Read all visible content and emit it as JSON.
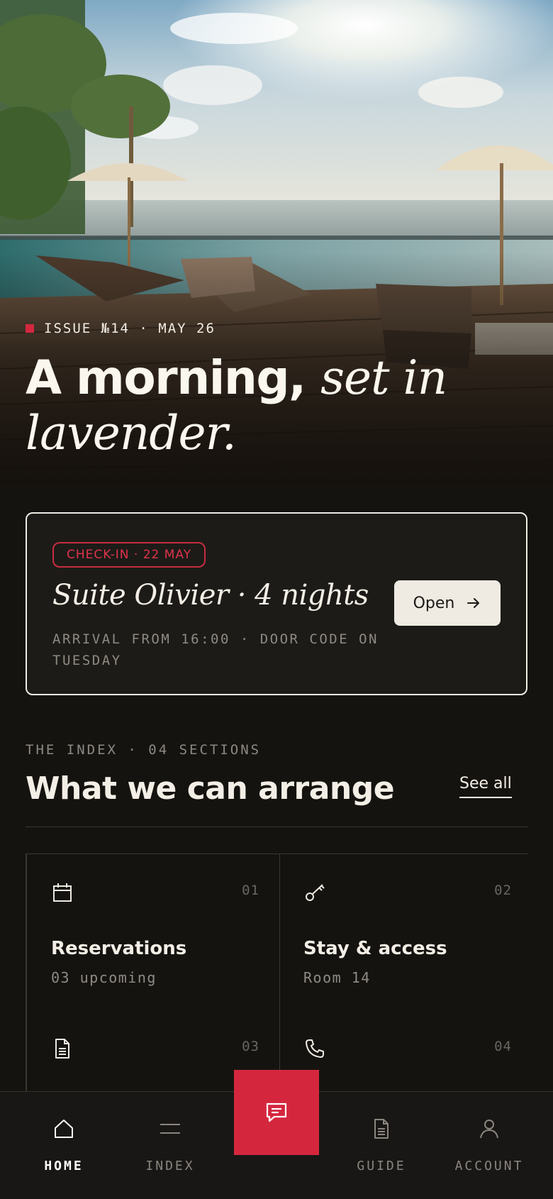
{
  "hero": {
    "issue_label": "ISSUE №14 · MAY 26",
    "headline_plain": "A morning,",
    "headline_italic": "set in lavender."
  },
  "checkin_card": {
    "badge": "CHECK-IN · 22 MAY",
    "title": "Suite Olivier · 4 nights",
    "details": "ARRIVAL FROM 16:00 · DOOR CODE ON TUESDAY",
    "button_label": "Open",
    "button_icon": "arrow-right-icon"
  },
  "index_section": {
    "eyebrow": "THE INDEX · 04 SECTIONS",
    "title": "What we can arrange",
    "see_all_label": "See all",
    "tiles": [
      {
        "number": "01",
        "name": "Reservations",
        "subtitle": "03 upcoming",
        "icon": "calendar-icon"
      },
      {
        "number": "02",
        "name": "Stay & access",
        "subtitle": "Room 14",
        "icon": "key-icon"
      },
      {
        "number": "03",
        "name": "",
        "subtitle": "",
        "icon": "document-icon"
      },
      {
        "number": "04",
        "name": "",
        "subtitle": "",
        "icon": "phone-icon"
      }
    ]
  },
  "bottom_nav": {
    "items": [
      {
        "label": "HOME",
        "icon": "home-icon",
        "active": true
      },
      {
        "label": "INDEX",
        "icon": "menu-icon",
        "active": false
      },
      {
        "label": "GUIDE",
        "icon": "document-icon",
        "active": false
      },
      {
        "label": "ACCOUNT",
        "icon": "user-icon",
        "active": false
      }
    ],
    "fab_icon": "chat-icon"
  },
  "colors": {
    "background": "#151310",
    "accent": "#d4273e",
    "text": "#f4efe6",
    "muted": "#8d8982"
  }
}
